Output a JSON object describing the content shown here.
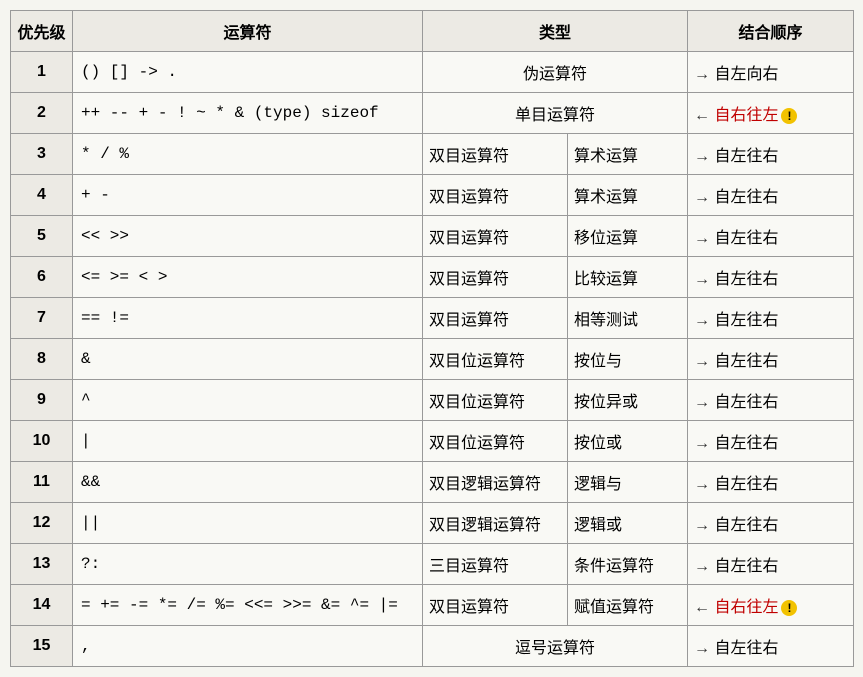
{
  "headers": {
    "priority": "优先级",
    "operator": "运算符",
    "type": "类型",
    "assoc": "结合顺序"
  },
  "rows": [
    {
      "priority": "1",
      "ops": "() [] -> .",
      "type": {
        "span": true,
        "text": "伪运算符"
      },
      "assoc": {
        "dir": "right",
        "text": "自左向右",
        "highlight": false
      }
    },
    {
      "priority": "2",
      "ops": "++ -- + - ! ~ * & (type) sizeof",
      "type": {
        "span": true,
        "text": "单目运算符"
      },
      "assoc": {
        "dir": "left",
        "text": "自右往左",
        "highlight": true
      }
    },
    {
      "priority": "3",
      "ops": "* / %",
      "type": {
        "span": false,
        "a": "双目运算符",
        "b": "算术运算"
      },
      "assoc": {
        "dir": "right",
        "text": "自左往右",
        "highlight": false
      }
    },
    {
      "priority": "4",
      "ops": "+ -",
      "type": {
        "span": false,
        "a": "双目运算符",
        "b": "算术运算"
      },
      "assoc": {
        "dir": "right",
        "text": "自左往右",
        "highlight": false
      }
    },
    {
      "priority": "5",
      "ops": "<< >>",
      "type": {
        "span": false,
        "a": "双目运算符",
        "b": "移位运算"
      },
      "assoc": {
        "dir": "right",
        "text": "自左往右",
        "highlight": false
      }
    },
    {
      "priority": "6",
      "ops": "<= >= < >",
      "type": {
        "span": false,
        "a": "双目运算符",
        "b": "比较运算"
      },
      "assoc": {
        "dir": "right",
        "text": "自左往右",
        "highlight": false
      }
    },
    {
      "priority": "7",
      "ops": "== !=",
      "type": {
        "span": false,
        "a": "双目运算符",
        "b": "相等测试"
      },
      "assoc": {
        "dir": "right",
        "text": "自左往右",
        "highlight": false
      }
    },
    {
      "priority": "8",
      "ops": "&",
      "type": {
        "span": false,
        "a": "双目位运算符",
        "b": "按位与"
      },
      "assoc": {
        "dir": "right",
        "text": "自左往右",
        "highlight": false
      }
    },
    {
      "priority": "9",
      "ops": "^",
      "type": {
        "span": false,
        "a": "双目位运算符",
        "b": "按位异或"
      },
      "assoc": {
        "dir": "right",
        "text": "自左往右",
        "highlight": false
      }
    },
    {
      "priority": "10",
      "ops": "|",
      "type": {
        "span": false,
        "a": "双目位运算符",
        "b": "按位或"
      },
      "assoc": {
        "dir": "right",
        "text": "自左往右",
        "highlight": false
      }
    },
    {
      "priority": "11",
      "ops": "&&",
      "type": {
        "span": false,
        "a": "双目逻辑运算符",
        "b": "逻辑与"
      },
      "assoc": {
        "dir": "right",
        "text": "自左往右",
        "highlight": false
      }
    },
    {
      "priority": "12",
      "ops": "||",
      "type": {
        "span": false,
        "a": "双目逻辑运算符",
        "b": "逻辑或"
      },
      "assoc": {
        "dir": "right",
        "text": "自左往右",
        "highlight": false
      }
    },
    {
      "priority": "13",
      "ops": "?:",
      "type": {
        "span": false,
        "a": "三目运算符",
        "b": "条件运算符"
      },
      "assoc": {
        "dir": "right",
        "text": "自左往右",
        "highlight": false
      }
    },
    {
      "priority": "14",
      "ops": "= += -= *= /= %= <<= >>= &= ^= |=",
      "type": {
        "span": false,
        "a": "双目运算符",
        "b": "赋值运算符"
      },
      "assoc": {
        "dir": "left",
        "text": "自右往左",
        "highlight": true
      }
    },
    {
      "priority": "15",
      "ops": ",",
      "type": {
        "span": true,
        "text": "逗号运算符"
      },
      "assoc": {
        "dir": "right",
        "text": "自左往右",
        "highlight": false
      }
    }
  ],
  "warn_glyph": "!"
}
